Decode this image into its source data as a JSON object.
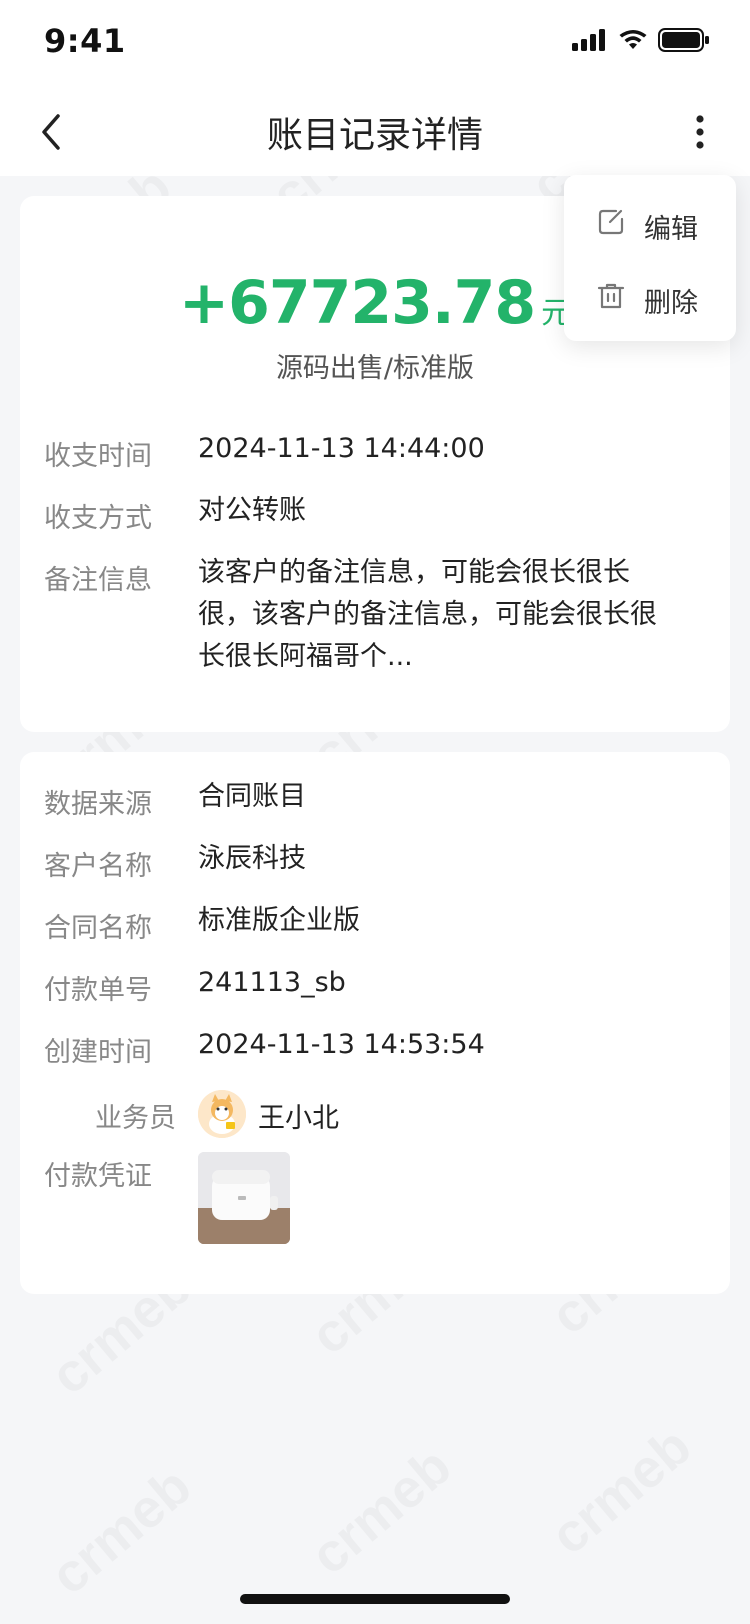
{
  "status_bar": {
    "time": "9:41"
  },
  "nav": {
    "title": "账目记录详情"
  },
  "menu": {
    "items": [
      {
        "label": "编辑",
        "icon": "edit-icon"
      },
      {
        "label": "删除",
        "icon": "trash-icon"
      }
    ]
  },
  "summary": {
    "amount": "+67723.78",
    "unit": "元",
    "category": "源码出售/标准版",
    "fields": [
      {
        "label": "收支时间",
        "value": "2024-11-13 14:44:00"
      },
      {
        "label": "收支方式",
        "value": "对公转账"
      },
      {
        "label": "备注信息",
        "value": "该客户的备注信息，可能会很长很长很，该客户的备注信息，可能会很长很长很长阿福哥个..."
      }
    ]
  },
  "details": {
    "fields": [
      {
        "label": "数据来源",
        "value": "合同账目"
      },
      {
        "label": "客户名称",
        "value": "泳辰科技"
      },
      {
        "label": "合同名称",
        "value": "标准版企业版"
      },
      {
        "label": "付款单号",
        "value": "241113_sb"
      },
      {
        "label": "创建时间",
        "value": "2024-11-13 14:53:54"
      }
    ],
    "salesperson": {
      "label": "业务员",
      "name": "王小北"
    },
    "voucher": {
      "label": "付款凭证"
    }
  },
  "watermark": "crmeb",
  "colors": {
    "accent": "#23b36a",
    "background": "#f5f6f8"
  }
}
